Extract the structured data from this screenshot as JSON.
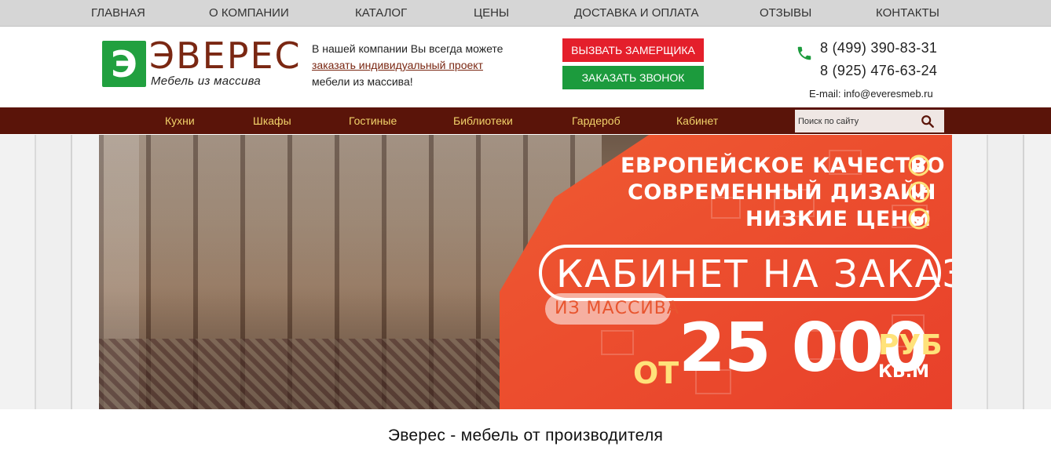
{
  "topnav": {
    "items": [
      "Главная",
      "О компании",
      "Каталог",
      "Цены",
      "Доставка и оплата",
      "Отзывы",
      "Контакты"
    ]
  },
  "header": {
    "logo_letter": "Э",
    "logo_name": "ЭВЕРЕС",
    "logo_tagline": "Мебель из массива",
    "promo_line1": "В нашей компании Вы всегда можете",
    "promo_link": "заказать индивидуальный проект",
    "promo_line3": "мебели из массива!",
    "btn_measure": "Вызвать замерщика",
    "btn_call": "Заказать звонок",
    "phone1": "8 (499) 390-83-31",
    "phone2": "8 (925) 476-63-24",
    "email_label": "E-mail:",
    "email": "info@everesmeb.ru"
  },
  "catnav": {
    "items": [
      "Кухни",
      "Шкафы",
      "Гостиные",
      "Библиотеки",
      "Гардероб",
      "Кабинет"
    ],
    "search_placeholder": "Поиск по сайту"
  },
  "banner": {
    "benefits": [
      "ЕВРОПЕЙСКОЕ КАЧЕСТВО",
      "СОВРЕМЕННЫЙ ДИЗАЙН",
      "НИЗКИЕ ЦЕНЫ"
    ],
    "headline": "КАБИНЕТ НА ЗАКАЗ",
    "material": "ИЗ МАССИВА",
    "price_from": "ОТ",
    "price": "25 000",
    "currency": "РУБ",
    "unit": "КВ.М"
  },
  "main": {
    "heading": "Эверес - мебель от производителя"
  },
  "colors": {
    "topnav_bg": "#d6d6d6",
    "brand_green": "#21a03f",
    "brand_brown": "#7a2712",
    "catnav_bg": "#5a1409",
    "catnav_text": "#f2d36a",
    "btn_red": "#e41f2b",
    "btn_green": "#1c9b3d",
    "banner_red": "#ec4a2c"
  }
}
